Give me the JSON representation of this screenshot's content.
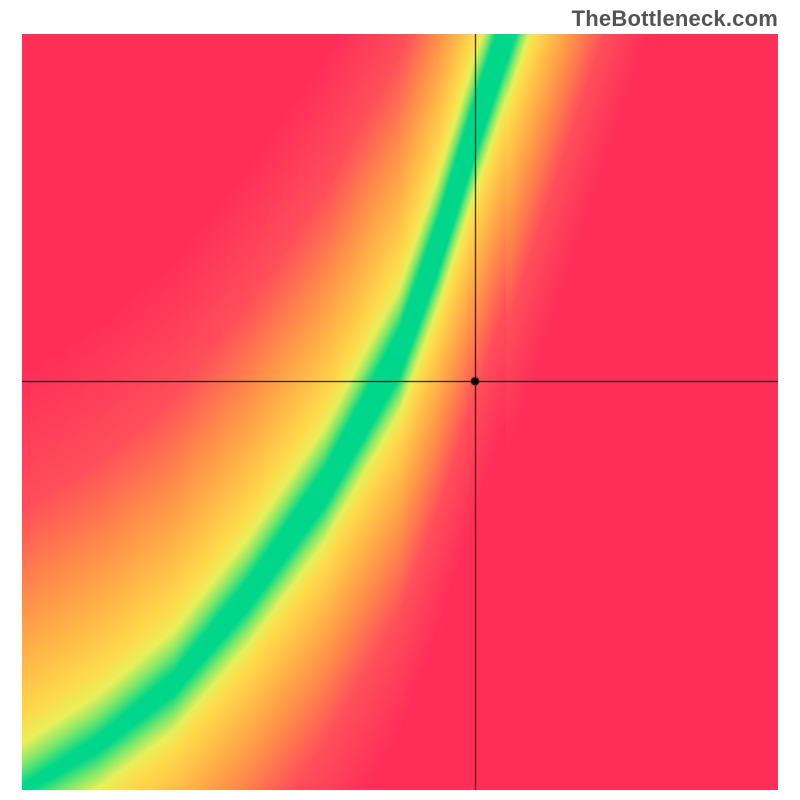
{
  "watermark": "TheBottleneck.com",
  "chart_data": {
    "type": "heatmap",
    "title": "",
    "xlabel": "",
    "ylabel": "",
    "x_range": [
      0,
      1
    ],
    "y_range": [
      0,
      1
    ],
    "crosshair": {
      "x": 0.6,
      "y": 0.54
    },
    "marker": {
      "x": 0.6,
      "y": 0.54,
      "shape": "circle",
      "color": "#000000",
      "radius_px": 4
    },
    "ridge_curve": {
      "description": "approximate locus of optimal (green) region; y expressed as function of x in normalized [0,1] coords",
      "points": [
        {
          "x": 0.0,
          "y": 0.0
        },
        {
          "x": 0.1,
          "y": 0.06
        },
        {
          "x": 0.2,
          "y": 0.14
        },
        {
          "x": 0.3,
          "y": 0.26
        },
        {
          "x": 0.4,
          "y": 0.4
        },
        {
          "x": 0.5,
          "y": 0.58
        },
        {
          "x": 0.55,
          "y": 0.72
        },
        {
          "x": 0.6,
          "y": 0.88
        },
        {
          "x": 0.64,
          "y": 1.0
        }
      ]
    },
    "ridge_width": {
      "description": "approximate half-width of the green band as fraction of x-axis, varies with x",
      "points": [
        {
          "x": 0.0,
          "w": 0.006
        },
        {
          "x": 0.2,
          "w": 0.015
        },
        {
          "x": 0.4,
          "w": 0.025
        },
        {
          "x": 0.55,
          "w": 0.035
        },
        {
          "x": 0.64,
          "w": 0.04
        }
      ]
    },
    "color_scale": {
      "description": "distance-from-ridge → color; 0=on ridge",
      "stops": [
        {
          "d": 0.0,
          "color": "#00D78A"
        },
        {
          "d": 0.06,
          "color": "#7FE86A"
        },
        {
          "d": 0.12,
          "color": "#E8F05A"
        },
        {
          "d": 0.2,
          "color": "#FFD94C"
        },
        {
          "d": 0.35,
          "color": "#FFB847"
        },
        {
          "d": 0.55,
          "color": "#FF8B4A"
        },
        {
          "d": 0.8,
          "color": "#FF4F5A"
        },
        {
          "d": 1.2,
          "color": "#FF2E59"
        }
      ]
    },
    "grid": false,
    "legend": false
  }
}
